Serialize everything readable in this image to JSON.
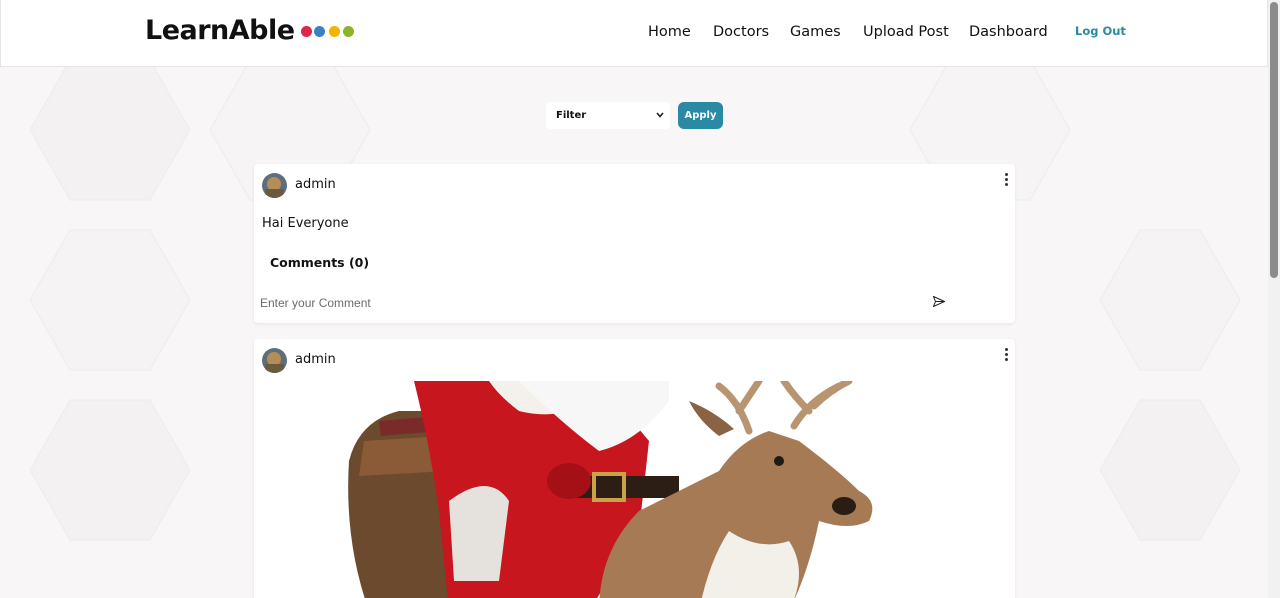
{
  "brand": {
    "name": "LearnAble",
    "dot_colors": [
      "#e0254a",
      "#3b82c4",
      "#f3b300",
      "#8db32a"
    ]
  },
  "nav": {
    "items": [
      {
        "label": "Home"
      },
      {
        "label": "Doctors"
      },
      {
        "label": "Games"
      },
      {
        "label": "Upload Post"
      },
      {
        "label": "Dashboard"
      }
    ],
    "logout_label": "Log Out"
  },
  "filter": {
    "selected": "Filter",
    "apply_label": "Apply"
  },
  "posts": [
    {
      "author": "admin",
      "text": "Hai Everyone",
      "comments_label": "Comments (0)",
      "comment_placeholder": "Enter your Comment"
    },
    {
      "author": "admin",
      "image_alt": "santa-riding-reindeer"
    }
  ],
  "colors": {
    "accent": "#2a8aa5",
    "background": "#f8f6f7"
  }
}
